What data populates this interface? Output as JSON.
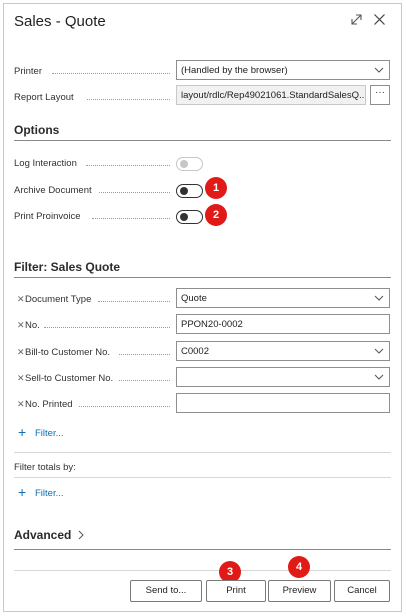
{
  "dialog": {
    "title": "Sales - Quote",
    "expand_icon": "expand-icon",
    "close_icon": "close-icon"
  },
  "printer": {
    "label": "Printer",
    "value": "(Handled by the browser)"
  },
  "report_layout": {
    "label": "Report Layout",
    "value": "layout/rdlc/Rep49021061.StandardSalesQ...",
    "button_label": "···"
  },
  "options": {
    "heading": "Options",
    "log_interaction": {
      "label": "Log Interaction",
      "state": "off-disabled"
    },
    "archive_document": {
      "label": "Archive Document",
      "state": "off"
    },
    "print_proinvoice": {
      "label": "Print Proinvoice",
      "state": "off"
    }
  },
  "badges": [
    "1",
    "2",
    "3",
    "4"
  ],
  "filter": {
    "heading": "Filter: Sales Quote",
    "rows": [
      {
        "label": "Document Type",
        "value": "Quote",
        "type": "select"
      },
      {
        "label": "No.",
        "value": "PPON20-0002",
        "type": "text"
      },
      {
        "label": "Bill-to Customer No.",
        "value": "C0002",
        "type": "select"
      },
      {
        "label": "Sell-to Customer No.",
        "value": "",
        "type": "select"
      },
      {
        "label": "No. Printed",
        "value": "",
        "type": "text"
      }
    ],
    "add_filter": "Filter..."
  },
  "filter_totals": {
    "label": "Filter totals by:",
    "add_filter": "Filter..."
  },
  "advanced": {
    "label": "Advanced"
  },
  "footer": {
    "send_to": "Send to...",
    "print": "Print",
    "preview": "Preview",
    "cancel": "Cancel"
  },
  "colors": {
    "badge": "#e11a17",
    "link": "#0c6eb3"
  }
}
